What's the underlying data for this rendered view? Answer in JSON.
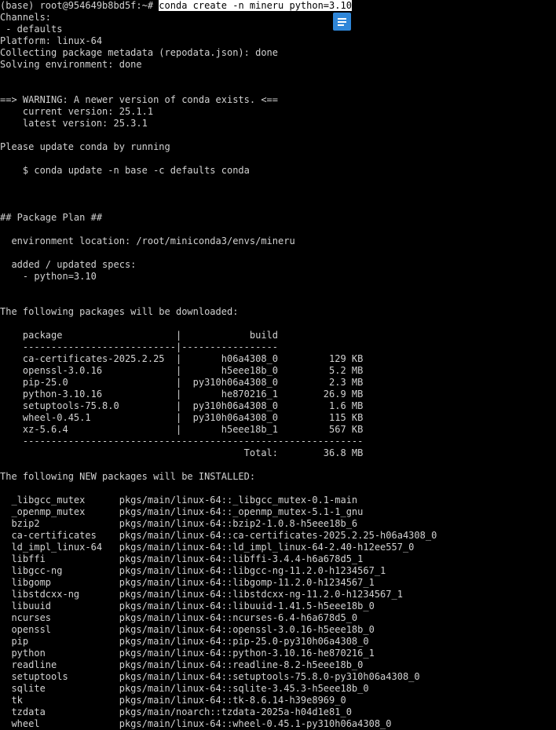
{
  "terminal": {
    "prompt": "(base) root@954649b8bd5f:~# ",
    "command": "conda create -n mineru python=3.10",
    "lines": [
      "Channels:",
      " - defaults",
      "Platform: linux-64",
      "Collecting package metadata (repodata.json): done",
      "Solving environment: done",
      "",
      "",
      "==> WARNING: A newer version of conda exists. <==",
      "    current version: 25.1.1",
      "    latest version: 25.3.1",
      "",
      "Please update conda by running",
      "",
      "    $ conda update -n base -c defaults conda",
      "",
      "",
      "",
      "## Package Plan ##",
      "",
      "  environment location: /root/miniconda3/envs/mineru",
      "",
      "  added / updated specs:",
      "    - python=3.10",
      "",
      "",
      "The following packages will be downloaded:",
      "",
      "    package                    |            build",
      "    ---------------------------|-----------------",
      "    ca-certificates-2025.2.25  |       h06a4308_0         129 KB",
      "    openssl-3.0.16             |       h5eee18b_0         5.2 MB",
      "    pip-25.0                   |  py310h06a4308_0         2.3 MB",
      "    python-3.10.16             |       he870216_1        26.9 MB",
      "    setuptools-75.8.0          |  py310h06a4308_0         1.6 MB",
      "    wheel-0.45.1               |  py310h06a4308_0         115 KB",
      "    xz-5.6.4                   |       h5eee18b_1         567 KB",
      "    ------------------------------------------------------------",
      "                                           Total:        36.8 MB",
      "",
      "The following NEW packages will be INSTALLED:",
      "",
      "  _libgcc_mutex      pkgs/main/linux-64::_libgcc_mutex-0.1-main",
      "  _openmp_mutex      pkgs/main/linux-64::_openmp_mutex-5.1-1_gnu",
      "  bzip2              pkgs/main/linux-64::bzip2-1.0.8-h5eee18b_6",
      "  ca-certificates    pkgs/main/linux-64::ca-certificates-2025.2.25-h06a4308_0",
      "  ld_impl_linux-64   pkgs/main/linux-64::ld_impl_linux-64-2.40-h12ee557_0",
      "  libffi             pkgs/main/linux-64::libffi-3.4.4-h6a678d5_1",
      "  libgcc-ng          pkgs/main/linux-64::libgcc-ng-11.2.0-h1234567_1",
      "  libgomp            pkgs/main/linux-64::libgomp-11.2.0-h1234567_1",
      "  libstdcxx-ng       pkgs/main/linux-64::libstdcxx-ng-11.2.0-h1234567_1",
      "  libuuid            pkgs/main/linux-64::libuuid-1.41.5-h5eee18b_0",
      "  ncurses            pkgs/main/linux-64::ncurses-6.4-h6a678d5_0",
      "  openssl            pkgs/main/linux-64::openssl-3.0.16-h5eee18b_0",
      "  pip                pkgs/main/linux-64::pip-25.0-py310h06a4308_0",
      "  python             pkgs/main/linux-64::python-3.10.16-he870216_1",
      "  readline           pkgs/main/linux-64::readline-8.2-h5eee18b_0",
      "  setuptools         pkgs/main/linux-64::setuptools-75.8.0-py310h06a4308_0",
      "  sqlite             pkgs/main/linux-64::sqlite-3.45.3-h5eee18b_0",
      "  tk                 pkgs/main/linux-64::tk-8.6.14-h39e8969_0",
      "  tzdata             pkgs/main/noarch::tzdata-2025a-h04d1e81_0",
      "  wheel              pkgs/main/linux-64::wheel-0.45.1-py310h06a4308_0"
    ]
  },
  "overlay_button": {
    "icon": "menu-lines-icon",
    "color": "#2f86d8"
  },
  "colors": {
    "background": "#000000",
    "text": "#d2d2d2",
    "selection_bg": "#ffffff",
    "selection_fg": "#000000"
  }
}
